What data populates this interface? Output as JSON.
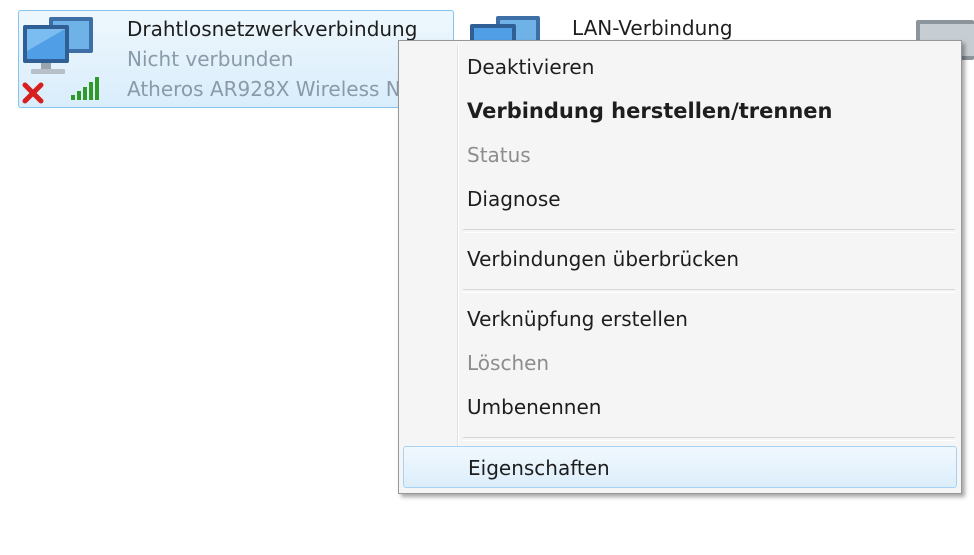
{
  "connections": [
    {
      "name": "Drahtlosnetzwerkverbindung",
      "status": "Nicht verbunden",
      "device": "Atheros AR928X Wireless N",
      "icon": "wireless-network-icon",
      "selected": true
    },
    {
      "name": "LAN-Verbindung",
      "icon": "lan-network-icon",
      "selected": false
    },
    {
      "icon": "network-adapter-icon",
      "selected": false
    }
  ],
  "context_menu": {
    "items": [
      {
        "label": "Deaktivieren",
        "state": "normal"
      },
      {
        "label": "Verbindung herstellen/trennen",
        "state": "default"
      },
      {
        "label": "Status",
        "state": "disabled"
      },
      {
        "label": "Diagnose",
        "state": "normal"
      },
      {
        "label": "Verbindungen überbrücken",
        "state": "normal"
      },
      {
        "label": "Verknüpfung erstellen",
        "state": "normal"
      },
      {
        "label": "Löschen",
        "state": "disabled"
      },
      {
        "label": "Umbenennen",
        "state": "normal"
      },
      {
        "label": "Eigenschaften",
        "state": "highlighted"
      }
    ]
  },
  "colors": {
    "selection_border": "#84c4ef",
    "selection_fill": "#d9edfb",
    "menu_background": "#f5f5f5",
    "disabled_text": "#8d8d8d",
    "error_red": "#d61f1f",
    "signal_green": "#2f9a2a"
  }
}
